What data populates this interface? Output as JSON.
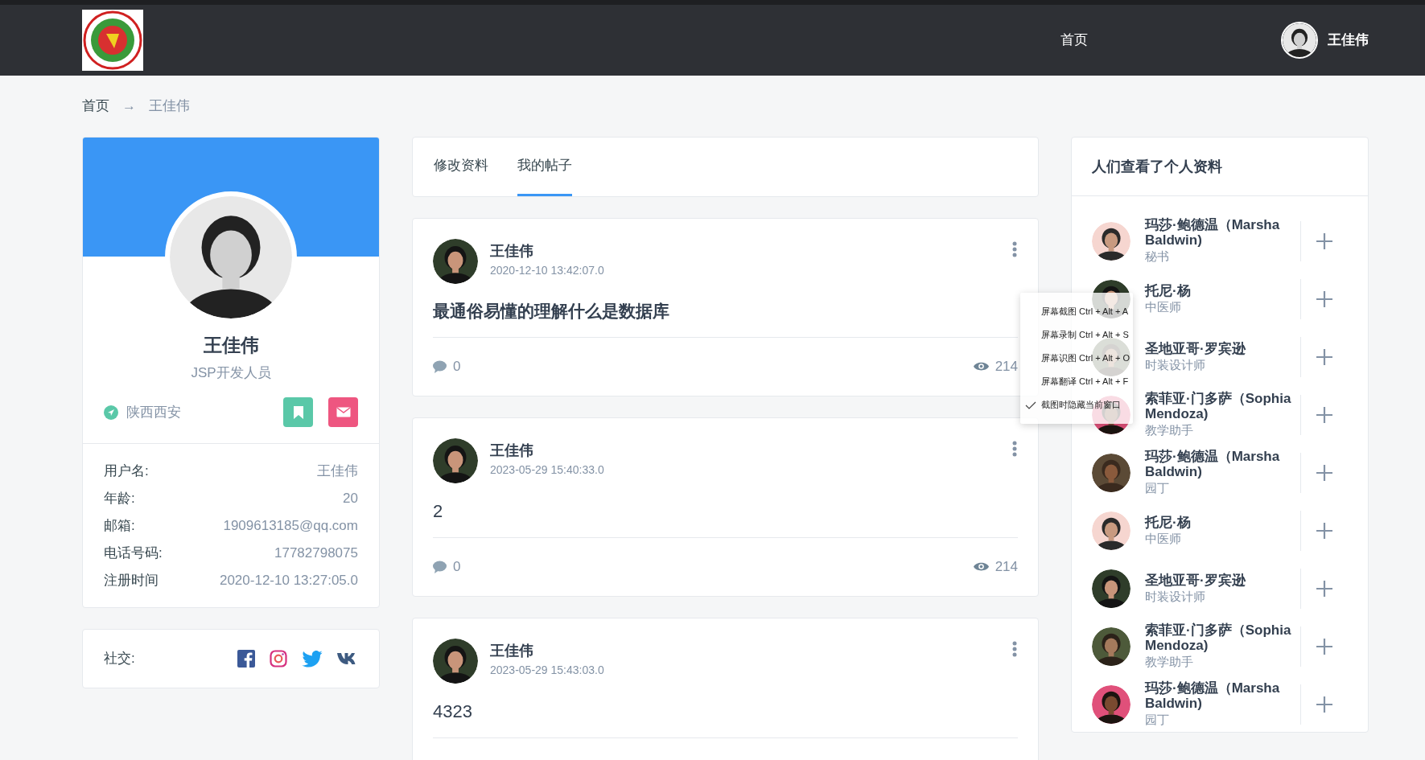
{
  "navbar": {
    "links": [
      {
        "label": "首页"
      }
    ],
    "user": {
      "name": "王佳伟"
    }
  },
  "breadcrumb": {
    "items": [
      {
        "label": "首页"
      },
      {
        "label": "王佳伟"
      }
    ],
    "separator": "→"
  },
  "profile": {
    "name": "王佳伟",
    "title": "JSP开发人员",
    "location": "陕西西安",
    "details": [
      {
        "label": "用户名:",
        "value": "王佳伟"
      },
      {
        "label": "年龄:",
        "value": "20"
      },
      {
        "label": "邮箱:",
        "value": "1909613185@qq.com"
      },
      {
        "label": "电话号码:",
        "value": "17782798075"
      },
      {
        "label": "注册时间",
        "value": "2020-12-10 13:27:05.0"
      }
    ],
    "social_label": "社交:"
  },
  "tabs": [
    {
      "label": "修改资料",
      "selected": false
    },
    {
      "label": "我的帖子",
      "selected": true
    }
  ],
  "posts": [
    {
      "author": "王佳伟",
      "date": "2020-12-10 13:42:07.0",
      "title": "最通俗易懂的理解什么是数据库",
      "title_bold": true,
      "comments": "0",
      "views": "214"
    },
    {
      "author": "王佳伟",
      "date": "2023-05-29 15:40:33.0",
      "title": "2",
      "title_bold": false,
      "comments": "0",
      "views": "214"
    },
    {
      "author": "王佳伟",
      "date": "2023-05-29 15:43:03.0",
      "title": "4323",
      "title_bold": false
    }
  ],
  "people": {
    "title": "人们查看了个人资料",
    "items": [
      {
        "name": "玛莎·鲍德温（Marsha Baldwin)",
        "role": "秘书"
      },
      {
        "name": "托尼·杨",
        "role": "中医师"
      },
      {
        "name": "圣地亚哥·罗宾逊",
        "role": "时装设计师"
      },
      {
        "name": "索菲亚·门多萨（Sophia Mendoza)",
        "role": "教学助手"
      },
      {
        "name": "玛莎·鲍德温（Marsha Baldwin)",
        "role": "园丁"
      },
      {
        "name": "托尼·杨",
        "role": "中医师"
      },
      {
        "name": "圣地亚哥·罗宾逊",
        "role": "时装设计师"
      },
      {
        "name": "索菲亚·门多萨（Sophia Mendoza)",
        "role": "教学助手"
      },
      {
        "name": "玛莎·鲍德温（Marsha Baldwin)",
        "role": "园丁"
      }
    ]
  },
  "context_menu": {
    "items": [
      {
        "label": "屏幕截图 Ctrl + Alt + A",
        "checked": false
      },
      {
        "label": "屏幕录制 Ctrl + Alt + S",
        "checked": false
      },
      {
        "label": "屏幕识图 Ctrl + Alt + O",
        "checked": false
      },
      {
        "label": "屏幕翻译 Ctrl + Alt + F",
        "checked": false
      },
      {
        "label": "截图时隐藏当前窗口",
        "checked": true
      }
    ]
  }
}
